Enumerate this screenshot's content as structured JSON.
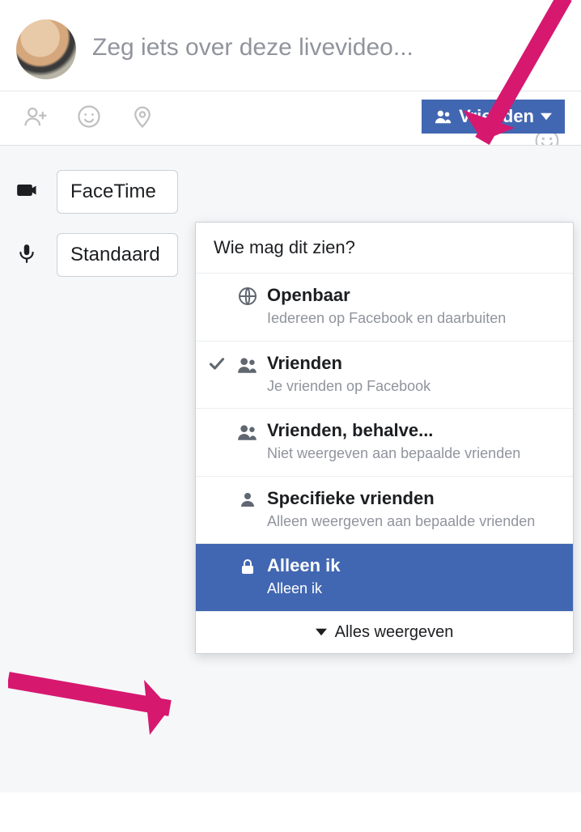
{
  "composer": {
    "placeholder": "Zeg iets over deze livevideo..."
  },
  "toolbar": {
    "privacy_button_label": "Vrienden"
  },
  "settings": {
    "camera_value": "FaceTime",
    "mic_value": "Standaard"
  },
  "dropdown": {
    "header": "Wie mag dit zien?",
    "options": [
      {
        "title": "Openbaar",
        "desc": "Iedereen op Facebook en daarbuiten"
      },
      {
        "title": "Vrienden",
        "desc": "Je vrienden op Facebook"
      },
      {
        "title": "Vrienden, behalve...",
        "desc": "Niet weergeven aan bepaalde vrienden"
      },
      {
        "title": "Specifieke vrienden",
        "desc": "Alleen weergeven aan bepaalde vrienden"
      },
      {
        "title": "Alleen ik",
        "desc": "Alleen ik"
      }
    ],
    "show_all": "Alles weergeven"
  }
}
